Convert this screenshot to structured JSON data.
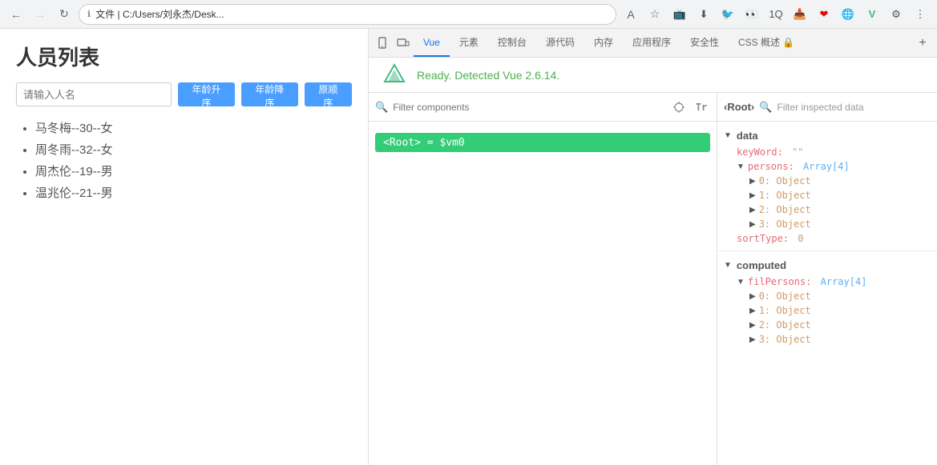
{
  "browser": {
    "back_btn": "←",
    "forward_btn": "→",
    "refresh_btn": "↻",
    "address_icon": "ℹ",
    "address_text": "文件  |  C:/Users/刘永杰/Desk...",
    "font_btn": "A",
    "star_btn": "☆",
    "toolbar_icons": [
      "📺",
      "⬇",
      "🐦",
      "👁",
      "1️⃣",
      "📥",
      "🔴",
      "🌐",
      "V",
      "⚙",
      "⋮"
    ]
  },
  "app": {
    "title": "人员列表",
    "search_placeholder": "请输入人名",
    "btn_age_asc": "年龄升序",
    "btn_age_desc": "年龄降序",
    "btn_original": "原顺序",
    "persons": [
      "马冬梅--30--女",
      "周冬雨--32--女",
      "周杰伦--19--男",
      "温兆伦--21--男"
    ]
  },
  "devtools": {
    "tabs": [
      {
        "label": "📱",
        "icon": true
      },
      {
        "label": "⬜",
        "icon": true
      },
      {
        "label": "Vue",
        "active": true
      },
      {
        "label": "元素"
      },
      {
        "label": "控制台"
      },
      {
        "label": "源代码"
      },
      {
        "label": "内存"
      },
      {
        "label": "应用程序"
      },
      {
        "label": "安全性"
      },
      {
        "label": "CSS 概述 🔒"
      }
    ],
    "plus": "+",
    "vue_ready": "Ready. Detected Vue 2.6.14.",
    "filter_components_placeholder": "Filter components",
    "root_component": "<Root> = $vm0",
    "filter_inspected_placeholder": "Filter inspected data",
    "breadcrumb_root": "‹Root›",
    "data_section": "data",
    "computed_section": "computed",
    "data_fields": {
      "keyword_key": "keyWord:",
      "keyword_value": "\"\"",
      "persons_key": "persons:",
      "persons_value": "Array[4]",
      "persons_items": [
        "0: Object",
        "1: Object",
        "2: Object",
        "3: Object"
      ],
      "sorttype_key": "sortType:",
      "sorttype_value": "0"
    },
    "computed_fields": {
      "filpersons_key": "filPersons:",
      "filpersons_value": "Array[4]",
      "filpersons_items": [
        "0: Object",
        "1: Object",
        "2: Object",
        "3: Object"
      ]
    }
  }
}
